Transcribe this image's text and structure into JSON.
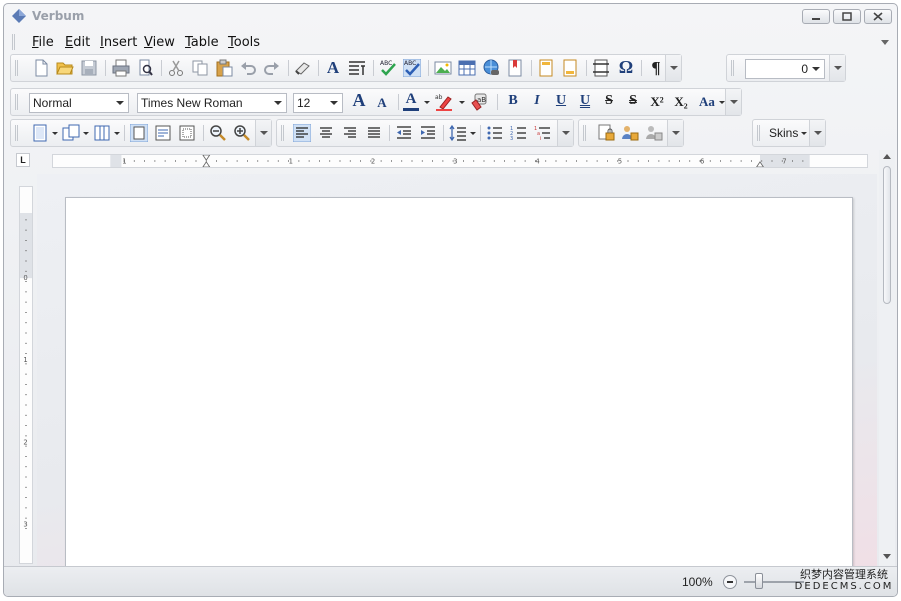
{
  "window": {
    "title": "Verbum"
  },
  "menu": [
    {
      "accel": "F",
      "rest": "ile"
    },
    {
      "accel": "E",
      "rest": "dit"
    },
    {
      "accel": "I",
      "rest": "nsert"
    },
    {
      "accel": "V",
      "rest": "iew"
    },
    {
      "accel": "T",
      "rest": "able"
    },
    {
      "accel": "T",
      "rest": "ools"
    }
  ],
  "formatting": {
    "style": "Normal",
    "font": "Times New Roman",
    "size": "12",
    "bold": "B",
    "italic": "I",
    "underline": "U",
    "double_underline": "U",
    "strike": "S",
    "double_strike": "S",
    "superscript": "X²",
    "subscript": "X₂",
    "change_case": "Aa",
    "grow_font": "A",
    "shrink_font": "A",
    "font_color": "A",
    "char_style": "A",
    "pilcrow": "¶",
    "omega": "Ω"
  },
  "indent_combo": {
    "value": "0"
  },
  "skins": {
    "label": "Skins"
  },
  "ruler": {
    "h_numbers": [
      "1",
      "1",
      "2",
      "3",
      "4",
      "5",
      "6",
      "7"
    ],
    "v_numbers": [
      "0",
      "1",
      "2",
      "3"
    ],
    "corner": "L"
  },
  "status": {
    "zoom": "100%"
  },
  "watermark": {
    "line1": "织梦内容管理系统",
    "line2": "DEDECMS.COM"
  },
  "colors": {
    "accent": "#1f3f7a",
    "chrome": "#e8eaee"
  }
}
